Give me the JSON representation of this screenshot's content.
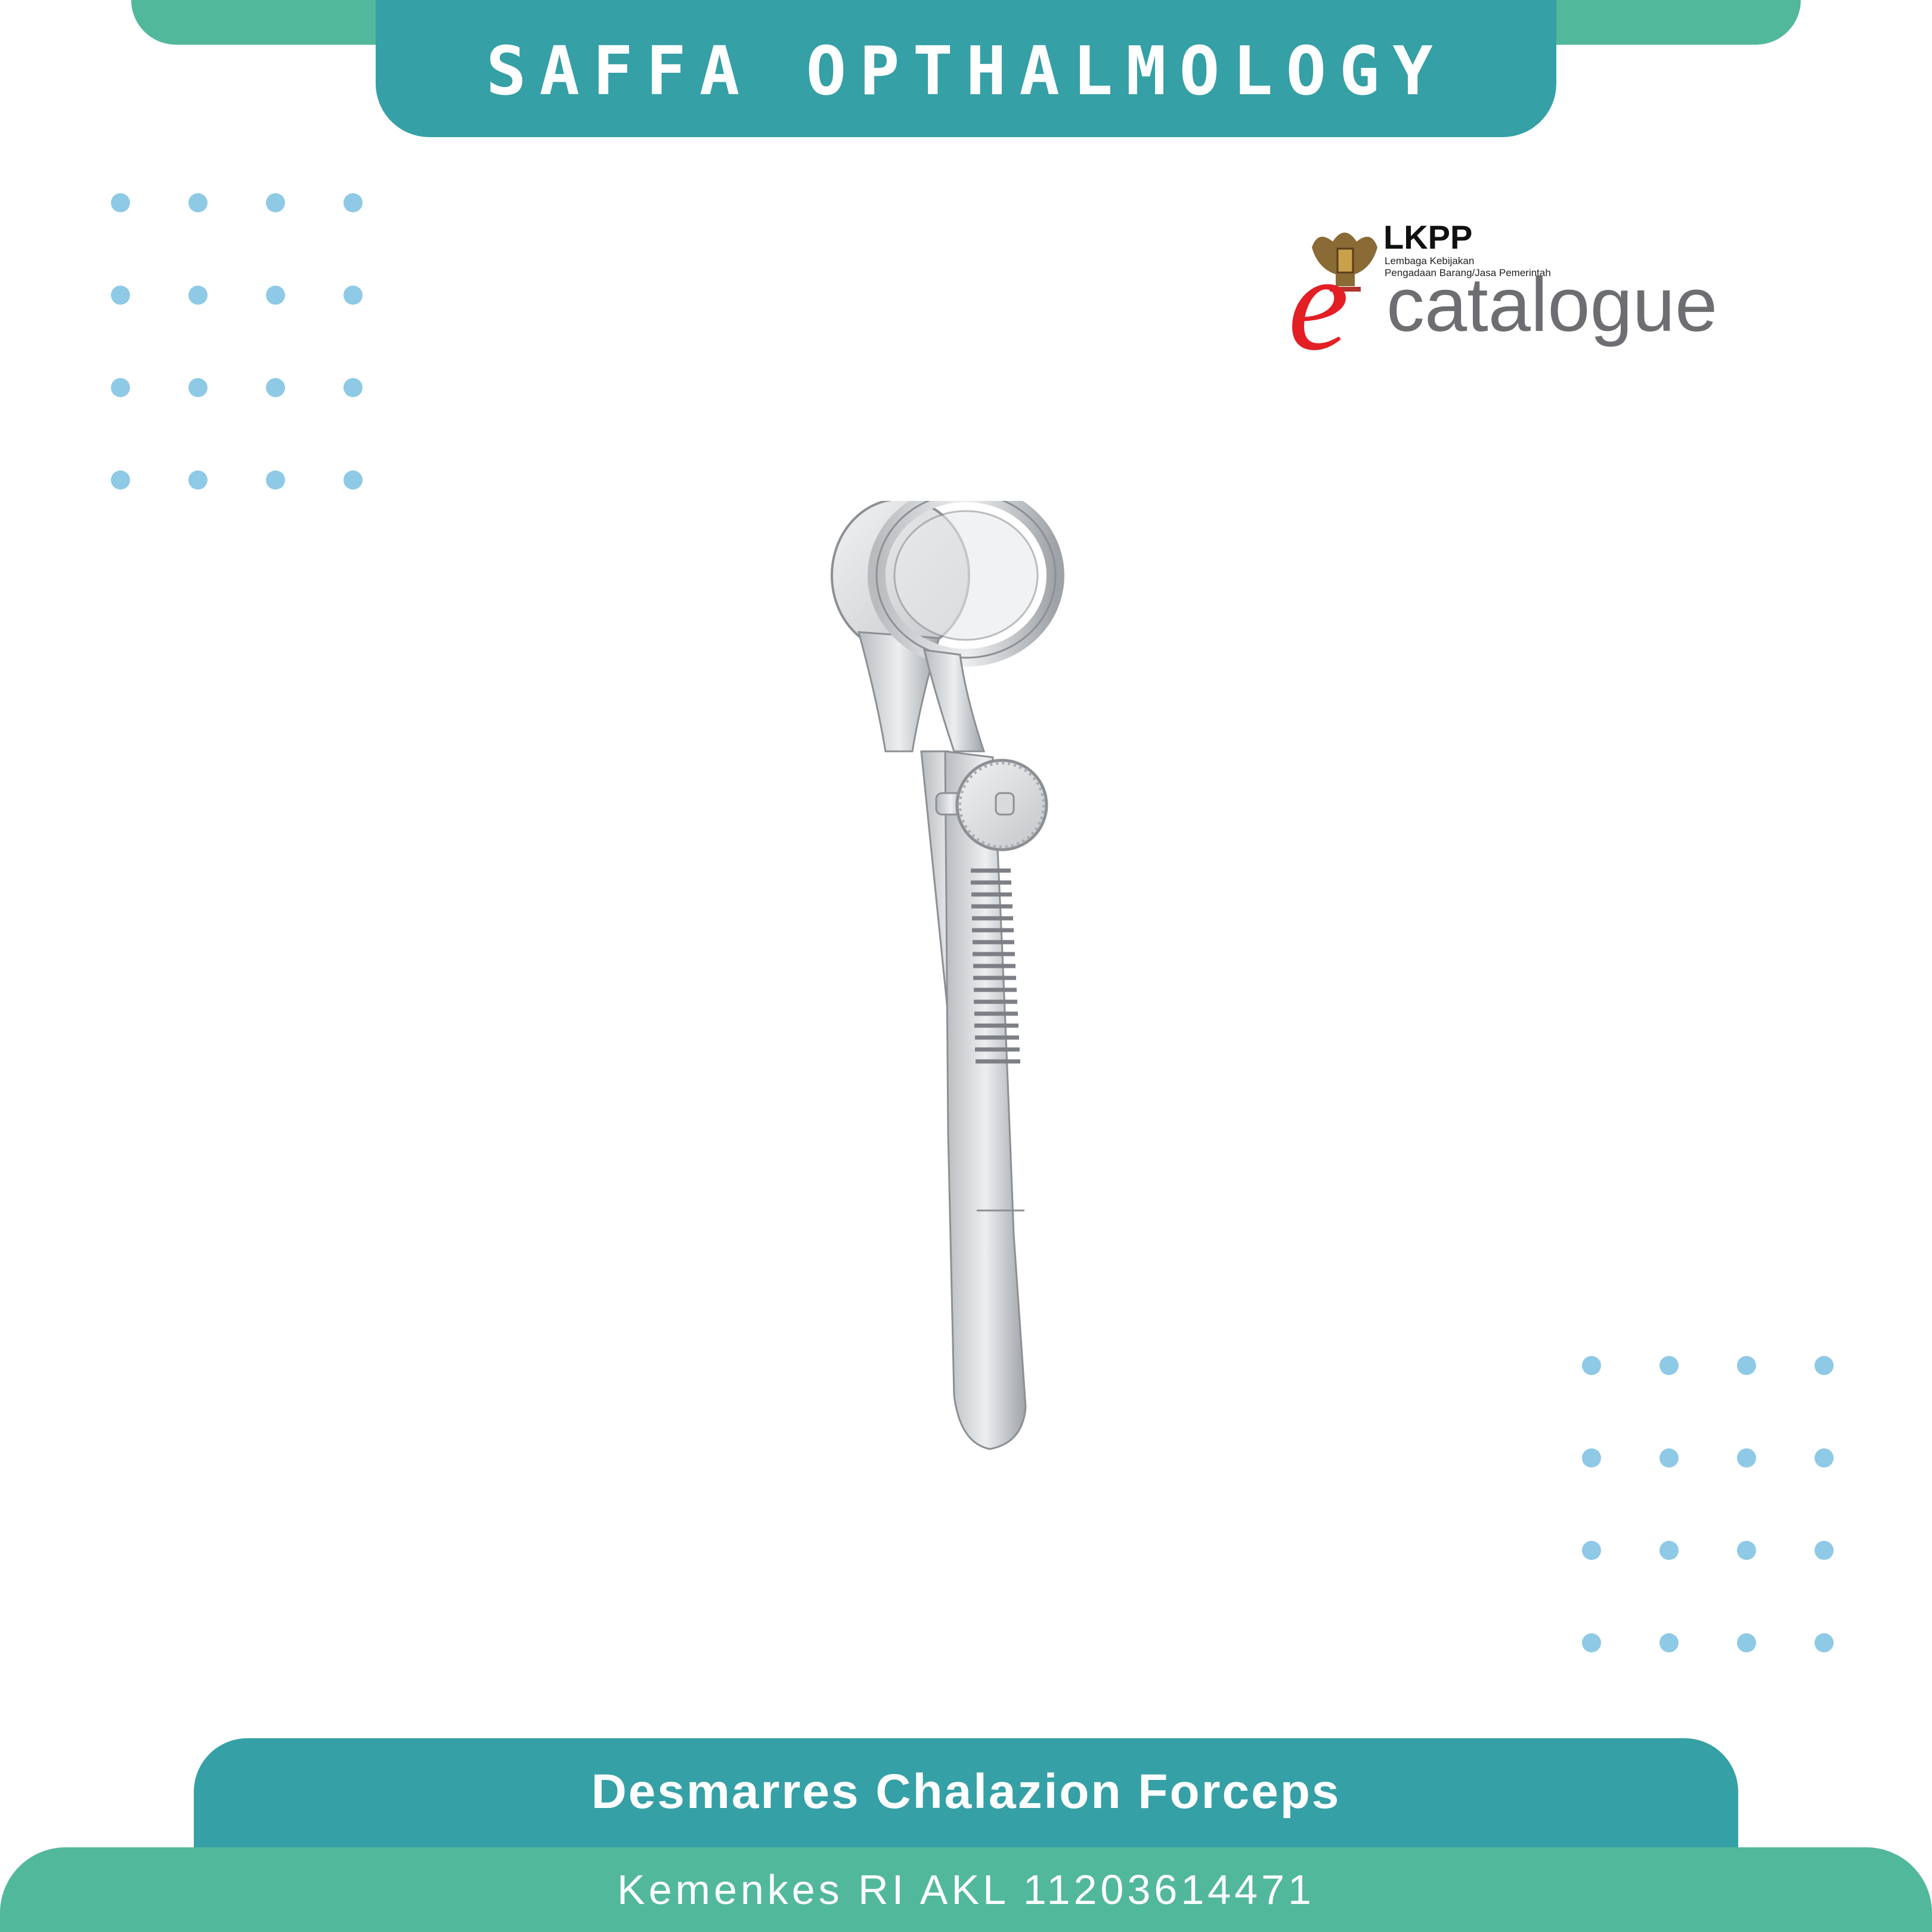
{
  "header": {
    "brand": "SAFFA OPTHALMOLOGY"
  },
  "logo": {
    "agency": "LKPP",
    "agency_line1": "Lembaga Kebijakan",
    "agency_line2": "Pengadaan Barang/Jasa Pemerintah",
    "e_letter": "e",
    "word": "catalogue"
  },
  "product": {
    "name": "Desmarres Chalazion Forceps"
  },
  "footer": {
    "license": "Kemenkes RI AKL 11203614471"
  },
  "colors": {
    "teal": "#35a0a5",
    "green": "#52b89b",
    "dot_blue": "#8ec9e6",
    "logo_red": "#e31e24",
    "logo_gray": "#6d6e71"
  }
}
